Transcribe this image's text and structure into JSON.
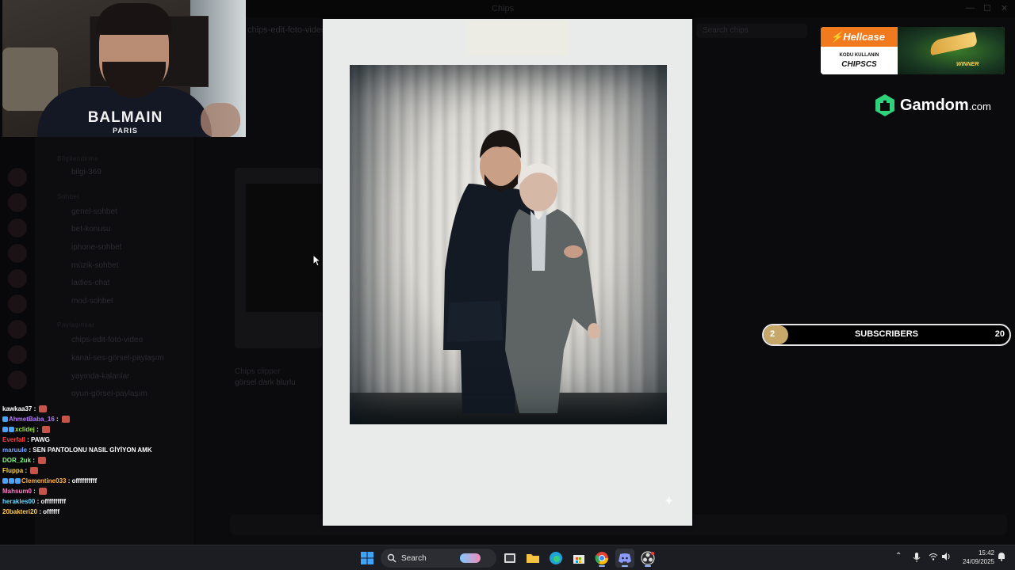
{
  "background": {
    "window_title": "Chips",
    "header_link": "chips-edit-foto-video-p",
    "search_placeholder": "Search chips",
    "categories": [
      "Bilgilendirme",
      "Sohbet",
      "Paylaşımlar"
    ],
    "channels": [
      "bilgi-369",
      "genel-sohbet",
      "bet-konusu",
      "iphone-sohbet",
      "müzik-sohbet",
      "ladies-chat",
      "mod-sohbet",
      "chips-edit-foto-video",
      "kanal-ses-görsel-paylaşım",
      "yayında-kalanlar",
      "oyun-görsel-paylaşım"
    ],
    "message_user": "Chips clipper",
    "message_text": "görsel dark blurlu"
  },
  "webcam": {
    "shirt_brand": "BALMAIN",
    "shirt_sub": "PARIS"
  },
  "chat": [
    {
      "user": "kawkaa37",
      "color": "#ffffff",
      "badges": 0,
      "text": "",
      "emote": true
    },
    {
      "user": "AhmetBaba_16",
      "color": "#b67dff",
      "badges": 1,
      "text": "",
      "emote": true
    },
    {
      "user": "xclidej",
      "color": "#9fe24a",
      "badges": 2,
      "text": "",
      "emote": true
    },
    {
      "user": "Everfall",
      "color": "#ff4040",
      "badges": 0,
      "text": "PAWG",
      "emote": false
    },
    {
      "user": "maruule",
      "color": "#7aa7ff",
      "badges": 0,
      "text": "SEN PANTOLONU NASIL GİYİYON AMK",
      "emote": false
    },
    {
      "user": "DOR_2uk",
      "color": "#7fff7f",
      "badges": 0,
      "text": "",
      "emote": true
    },
    {
      "user": "Fluppa",
      "color": "#ffd34a",
      "badges": 0,
      "text": "",
      "emote": true
    },
    {
      "user": "Clementine033",
      "color": "#ffb347",
      "badges": 3,
      "text": "offffffffff",
      "emote": false
    },
    {
      "user": "Mahsum0",
      "color": "#ff7ac8",
      "badges": 0,
      "text": "",
      "emote": true
    },
    {
      "user": "herakles00",
      "color": "#66d9ff",
      "badges": 0,
      "text": "offffffffff",
      "emote": false
    },
    {
      "user": "20bakteri20",
      "color": "#ffcc4d",
      "badges": 0,
      "text": "offffff",
      "emote": false
    }
  ],
  "sponsor": {
    "brand": "Hellcase",
    "code_label": "KODU KULLANIN",
    "code": "CHIPSCS",
    "winner": "WINNER"
  },
  "gamdom": {
    "name": "Gamdom",
    "tld": ".com"
  },
  "subscribers": {
    "label": "SUBSCRIBERS",
    "current": "2",
    "goal": "20",
    "progress_fraction": 0.1,
    "fill_color": "#c8a86a"
  },
  "taskbar": {
    "search_label": "Search",
    "time": "15:42",
    "date": "24/09/2025",
    "apps": [
      "windows-start",
      "widgets",
      "task-view",
      "file-explorer",
      "edge",
      "microsoft-store",
      "chrome",
      "discord",
      "obs"
    ]
  }
}
